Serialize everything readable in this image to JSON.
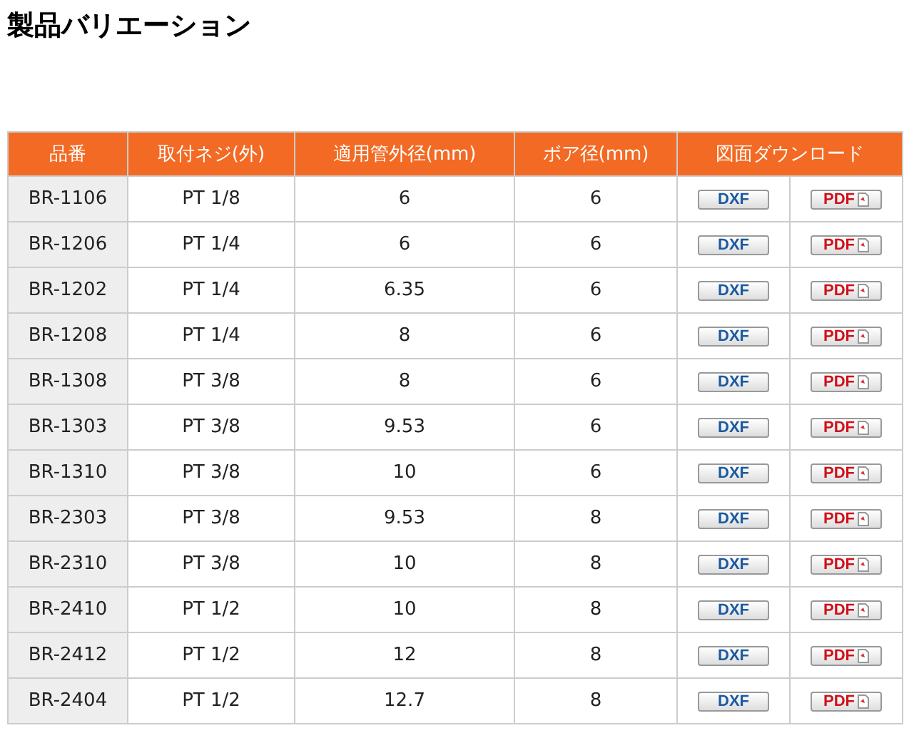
{
  "title": "製品バリエーション",
  "table": {
    "columns": [
      "品番",
      "取付ネジ(外)",
      "適用管外径(mm)",
      "ボア径(mm)",
      "図面ダウンロード"
    ],
    "rows": [
      {
        "part": "BR-1106",
        "thread": "PT 1/8",
        "outer": "6",
        "bore": "6",
        "dxf": "DXF",
        "pdf": "PDF"
      },
      {
        "part": "BR-1206",
        "thread": "PT 1/4",
        "outer": "6",
        "bore": "6",
        "dxf": "DXF",
        "pdf": "PDF"
      },
      {
        "part": "BR-1202",
        "thread": "PT 1/4",
        "outer": "6.35",
        "bore": "6",
        "dxf": "DXF",
        "pdf": "PDF"
      },
      {
        "part": "BR-1208",
        "thread": "PT 1/4",
        "outer": "8",
        "bore": "6",
        "dxf": "DXF",
        "pdf": "PDF"
      },
      {
        "part": "BR-1308",
        "thread": "PT 3/8",
        "outer": "8",
        "bore": "6",
        "dxf": "DXF",
        "pdf": "PDF"
      },
      {
        "part": "BR-1303",
        "thread": "PT 3/8",
        "outer": "9.53",
        "bore": "6",
        "dxf": "DXF",
        "pdf": "PDF"
      },
      {
        "part": "BR-1310",
        "thread": "PT 3/8",
        "outer": "10",
        "bore": "6",
        "dxf": "DXF",
        "pdf": "PDF"
      },
      {
        "part": "BR-2303",
        "thread": "PT 3/8",
        "outer": "9.53",
        "bore": "8",
        "dxf": "DXF",
        "pdf": "PDF"
      },
      {
        "part": "BR-2310",
        "thread": "PT 3/8",
        "outer": "10",
        "bore": "8",
        "dxf": "DXF",
        "pdf": "PDF"
      },
      {
        "part": "BR-2410",
        "thread": "PT 1/2",
        "outer": "10",
        "bore": "8",
        "dxf": "DXF",
        "pdf": "PDF"
      },
      {
        "part": "BR-2412",
        "thread": "PT 1/2",
        "outer": "12",
        "bore": "8",
        "dxf": "DXF",
        "pdf": "PDF"
      },
      {
        "part": "BR-2404",
        "thread": "PT 1/2",
        "outer": "12.7",
        "bore": "8",
        "dxf": "DXF",
        "pdf": "PDF"
      }
    ]
  }
}
